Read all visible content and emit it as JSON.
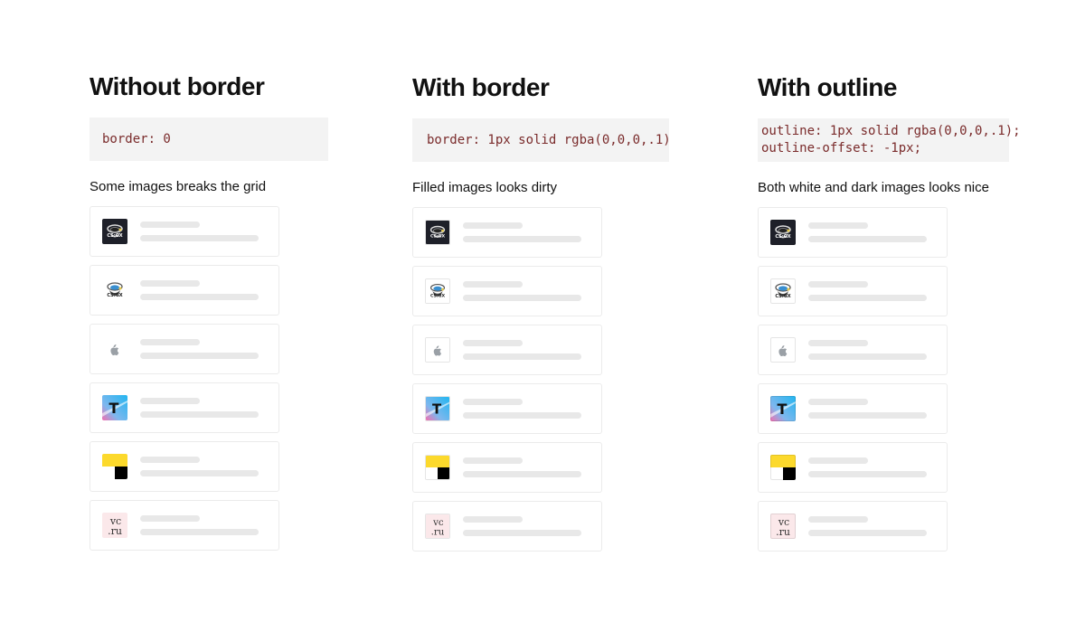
{
  "columns": [
    {
      "title": "Without border",
      "code": "border: 0",
      "caption": "Some images breaks the grid",
      "logo_style": "none"
    },
    {
      "title": "With border",
      "code": "border: 1px solid rgba(0,0,0,.1)",
      "caption": "Filled images looks dirty",
      "logo_style": "border"
    },
    {
      "title": "With outline",
      "code": "outline: 1px solid rgba(0,0,0,.1);\noutline-offset: -1px;",
      "caption": "Both white and dark images looks nice",
      "logo_style": "outline"
    }
  ],
  "logos": [
    {
      "name": "dark-mascot-logo",
      "icon": "mascot-dark-icon"
    },
    {
      "name": "white-mascot-logo",
      "icon": "mascot-light-icon"
    },
    {
      "name": "apple-logo",
      "icon": "apple-icon"
    },
    {
      "name": "t-gradient-logo",
      "icon": "t-letter-icon"
    },
    {
      "name": "yandex-squares-logo",
      "icon": "yellow-black-squares-icon"
    },
    {
      "name": "vc-ru-logo",
      "icon": "vc-ru-icon",
      "text_top": "vc",
      "text_bottom": ".ru"
    }
  ],
  "colors": {
    "code_bg": "#f3f3f3",
    "code_text": "#7a2b2b",
    "card_border": "#ebebeb",
    "skeleton": "#e8e8e8"
  }
}
